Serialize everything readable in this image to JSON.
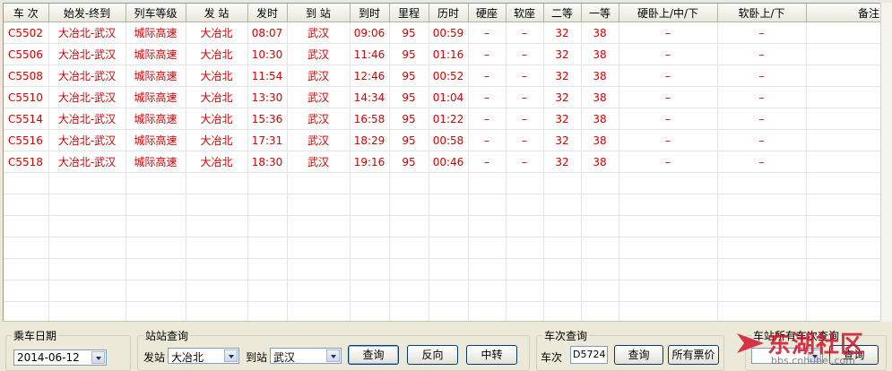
{
  "columns": [
    "车 次",
    "始发-终到",
    "列车等级",
    "发 站",
    "发时",
    "到 站",
    "到时",
    "里程",
    "历时",
    "硬座",
    "软座",
    "二等",
    "一等",
    "硬卧上/中/下",
    "软卧上/下",
    "备注"
  ],
  "rows": [
    [
      "C5502",
      "大冶北-武汉",
      "城际高速",
      "大冶北",
      "08:07",
      "武汉",
      "09:06",
      "95",
      "00:59",
      "–",
      "–",
      "32",
      "38",
      "–",
      "–",
      ""
    ],
    [
      "C5506",
      "大冶北-武汉",
      "城际高速",
      "大冶北",
      "10:30",
      "武汉",
      "11:46",
      "95",
      "01:16",
      "–",
      "–",
      "32",
      "38",
      "–",
      "–",
      ""
    ],
    [
      "C5508",
      "大冶北-武汉",
      "城际高速",
      "大冶北",
      "11:54",
      "武汉",
      "12:46",
      "95",
      "00:52",
      "–",
      "–",
      "32",
      "38",
      "–",
      "–",
      ""
    ],
    [
      "C5510",
      "大冶北-武汉",
      "城际高速",
      "大冶北",
      "13:30",
      "武汉",
      "14:34",
      "95",
      "01:04",
      "–",
      "–",
      "32",
      "38",
      "–",
      "–",
      ""
    ],
    [
      "C5514",
      "大冶北-武汉",
      "城际高速",
      "大冶北",
      "15:36",
      "武汉",
      "16:58",
      "95",
      "01:22",
      "–",
      "–",
      "32",
      "38",
      "–",
      "–",
      ""
    ],
    [
      "C5516",
      "大冶北-武汉",
      "城际高速",
      "大冶北",
      "17:31",
      "武汉",
      "18:29",
      "95",
      "00:58",
      "–",
      "–",
      "32",
      "38",
      "–",
      "–",
      ""
    ],
    [
      "C5518",
      "大冶北-武汉",
      "城际高速",
      "大冶北",
      "18:30",
      "武汉",
      "19:16",
      "95",
      "00:46",
      "–",
      "–",
      "32",
      "38",
      "–",
      "–",
      ""
    ]
  ],
  "date_group": {
    "legend": "乘车日期",
    "value": "2014-06-12"
  },
  "station_group": {
    "legend": "站站查询",
    "from_label": "发站",
    "from_value": "大冶北",
    "to_label": "到站",
    "to_value": "武汉",
    "query_btn": "查询",
    "reverse_btn": "反向",
    "transfer_btn": "中转"
  },
  "train_group": {
    "legend": "车次查询",
    "train_label": "车次",
    "train_value": "D5724",
    "query_btn": "查询",
    "all_fares_btn": "所有票价"
  },
  "station_train_group": {
    "legend": "车站所有车次查询",
    "query_btn": "查询"
  },
  "watermark": {
    "brand": "东湖社区",
    "url": "bbs.cnhubei.com"
  },
  "colors": {
    "data_text": "#d20000",
    "window_bg": "#ece9d8",
    "button_border": "#003c74",
    "watermark": "#d0142c"
  }
}
